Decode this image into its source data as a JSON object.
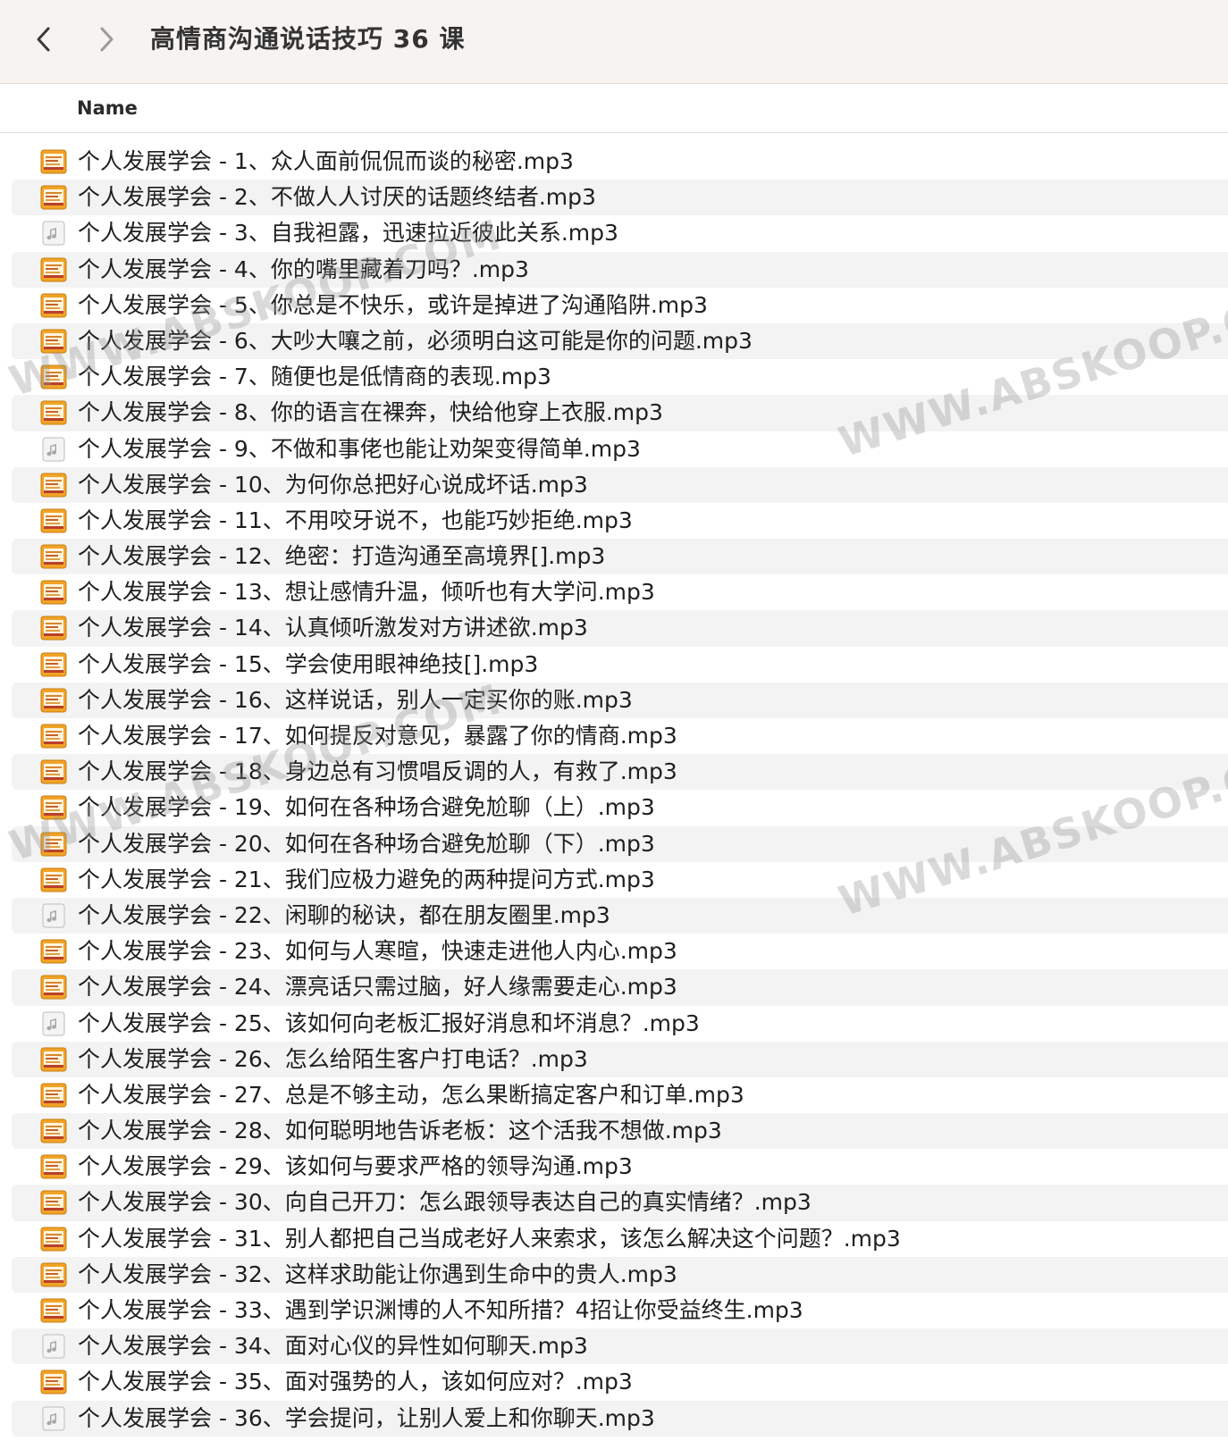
{
  "window": {
    "title": "高情商沟通说话技巧 36 课"
  },
  "toolbar": {
    "back_icon": "chevron-left-icon",
    "forward_icon": "chevron-right-icon"
  },
  "columns": {
    "name": "Name"
  },
  "watermark_text": "WWW.ABSKOOP.COM",
  "files": [
    {
      "name": "个人发展学会 - 1、众人面前侃侃而谈的秘密.mp3",
      "icon": "audio-artwork-icon"
    },
    {
      "name": "个人发展学会 - 2、不做人人讨厌的话题终结者.mp3",
      "icon": "audio-artwork-icon"
    },
    {
      "name": "个人发展学会 - 3、自我袒露，迅速拉近彼此关系.mp3",
      "icon": "audio-generic-icon"
    },
    {
      "name": "个人发展学会 - 4、你的嘴里藏着刀吗？.mp3",
      "icon": "audio-artwork-icon"
    },
    {
      "name": "个人发展学会 - 5、你总是不快乐，或许是掉进了沟通陷阱.mp3",
      "icon": "audio-artwork-icon"
    },
    {
      "name": "个人发展学会 - 6、大吵大嚷之前，必须明白这可能是你的问题.mp3",
      "icon": "audio-artwork-icon"
    },
    {
      "name": "个人发展学会 - 7、随便也是低情商的表现.mp3",
      "icon": "audio-artwork-icon"
    },
    {
      "name": "个人发展学会 - 8、你的语言在裸奔，快给他穿上衣服.mp3",
      "icon": "audio-artwork-icon"
    },
    {
      "name": "个人发展学会 - 9、不做和事佬也能让劝架变得简单.mp3",
      "icon": "audio-generic-icon"
    },
    {
      "name": "个人发展学会 - 10、为何你总把好心说成坏话.mp3",
      "icon": "audio-artwork-icon"
    },
    {
      "name": "个人发展学会 - 11、不用咬牙说不，也能巧妙拒绝.mp3",
      "icon": "audio-artwork-icon"
    },
    {
      "name": "个人发展学会 - 12、绝密：打造沟通至高境界[].mp3",
      "icon": "audio-artwork-icon"
    },
    {
      "name": "个人发展学会 - 13、想让感情升温，倾听也有大学问.mp3",
      "icon": "audio-artwork-icon"
    },
    {
      "name": "个人发展学会 - 14、认真倾听激发对方讲述欲.mp3",
      "icon": "audio-artwork-icon"
    },
    {
      "name": "个人发展学会 - 15、学会使用眼神绝技[].mp3",
      "icon": "audio-artwork-icon"
    },
    {
      "name": "个人发展学会 - 16、这样说话，别人一定买你的账.mp3",
      "icon": "audio-artwork-icon"
    },
    {
      "name": "个人发展学会 - 17、如何提反对意见，暴露了你的情商.mp3",
      "icon": "audio-artwork-icon"
    },
    {
      "name": "个人发展学会 - 18、身边总有习惯唱反调的人，有救了.mp3",
      "icon": "audio-artwork-icon"
    },
    {
      "name": "个人发展学会 - 19、如何在各种场合避免尬聊（上）.mp3",
      "icon": "audio-artwork-icon"
    },
    {
      "name": "个人发展学会 - 20、如何在各种场合避免尬聊（下）.mp3",
      "icon": "audio-artwork-icon"
    },
    {
      "name": "个人发展学会 - 21、我们应极力避免的两种提问方式.mp3",
      "icon": "audio-artwork-icon"
    },
    {
      "name": "个人发展学会 - 22、闲聊的秘诀，都在朋友圈里.mp3",
      "icon": "audio-generic-icon"
    },
    {
      "name": "个人发展学会 - 23、如何与人寒暄，快速走进他人内心.mp3",
      "icon": "audio-artwork-icon"
    },
    {
      "name": "个人发展学会 - 24、漂亮话只需过脑，好人缘需要走心.mp3",
      "icon": "audio-artwork-icon"
    },
    {
      "name": "个人发展学会 - 25、该如何向老板汇报好消息和坏消息？.mp3",
      "icon": "audio-generic-icon"
    },
    {
      "name": "个人发展学会 - 26、怎么给陌生客户打电话？.mp3",
      "icon": "audio-artwork-icon"
    },
    {
      "name": "个人发展学会 - 27、总是不够主动，怎么果断搞定客户和订单.mp3",
      "icon": "audio-artwork-icon"
    },
    {
      "name": "个人发展学会 - 28、如何聪明地告诉老板：这个活我不想做.mp3",
      "icon": "audio-artwork-icon"
    },
    {
      "name": "个人发展学会 - 29、该如何与要求严格的领导沟通.mp3",
      "icon": "audio-artwork-icon"
    },
    {
      "name": "个人发展学会 - 30、向自己开刀：怎么跟领导表达自己的真实情绪？.mp3",
      "icon": "audio-artwork-icon"
    },
    {
      "name": "个人发展学会 - 31、别人都把自己当成老好人来索求，该怎么解决这个问题？.mp3",
      "icon": "audio-artwork-icon"
    },
    {
      "name": "个人发展学会 - 32、这样求助能让你遇到生命中的贵人.mp3",
      "icon": "audio-artwork-icon"
    },
    {
      "name": "个人发展学会 - 33、遇到学识渊博的人不知所措？4招让你受益终生.mp3",
      "icon": "audio-artwork-icon"
    },
    {
      "name": "个人发展学会 - 34、面对心仪的异性如何聊天.mp3",
      "icon": "audio-generic-icon"
    },
    {
      "name": "个人发展学会 - 35、面对强势的人，该如何应对？.mp3",
      "icon": "audio-artwork-icon"
    },
    {
      "name": "个人发展学会 - 36、学会提问，让别人爱上和你聊天.mp3",
      "icon": "audio-generic-icon"
    }
  ],
  "colors": {
    "toolbar_bg": "#f6f3f1",
    "row_alt_bg": "#f3f3f3",
    "text": "#1f1f1f"
  }
}
